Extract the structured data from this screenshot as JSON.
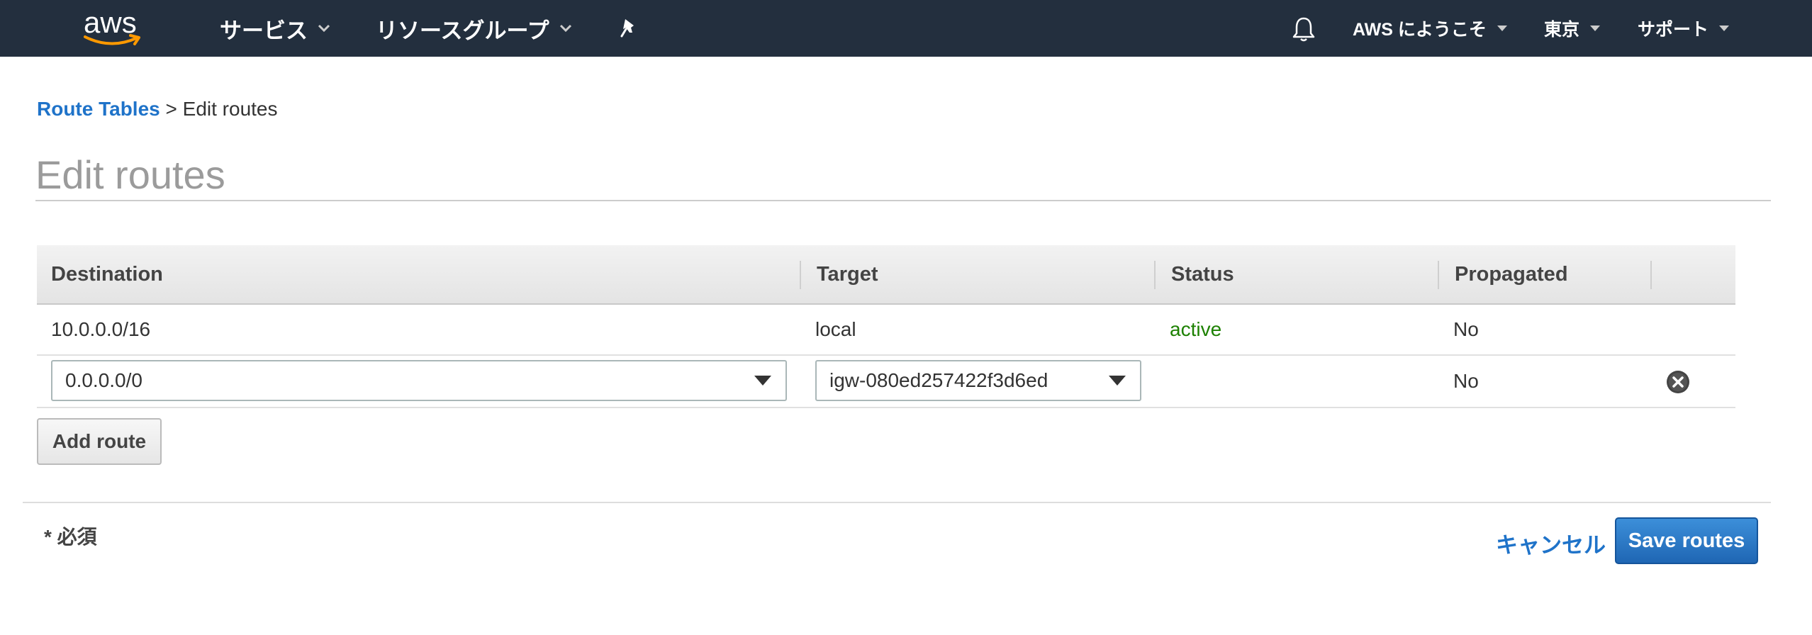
{
  "nav": {
    "logo_text": "aws",
    "services": "サービス",
    "resource_groups": "リソースグループ",
    "pin_icon": "pin-icon",
    "bell_icon": "bell-icon",
    "account": "AWS にようこそ",
    "region": "東京",
    "support": "サポート"
  },
  "breadcrumb": {
    "parent": "Route Tables",
    "separator": ">",
    "current": "Edit routes"
  },
  "page": {
    "title": "Edit routes"
  },
  "table": {
    "columns": [
      "Destination",
      "Target",
      "Status",
      "Propagated"
    ],
    "rows": [
      {
        "destination": "10.0.0.0/16",
        "target": "local",
        "status": "active",
        "propagated": "No"
      },
      {
        "destination": "0.0.0.0/0",
        "target": "igw-080ed257422f3d6ed",
        "status": "",
        "propagated": "No"
      }
    ]
  },
  "actions": {
    "add_route": "Add route",
    "required_note": "* 必須",
    "cancel": "キャンセル",
    "save": "Save routes"
  },
  "colors": {
    "nav_bg": "#232f3e",
    "link": "#1f73c9",
    "status_active": "#1d8102",
    "primary_button": "#1f66b4",
    "logo_smile": "#ff9900"
  }
}
